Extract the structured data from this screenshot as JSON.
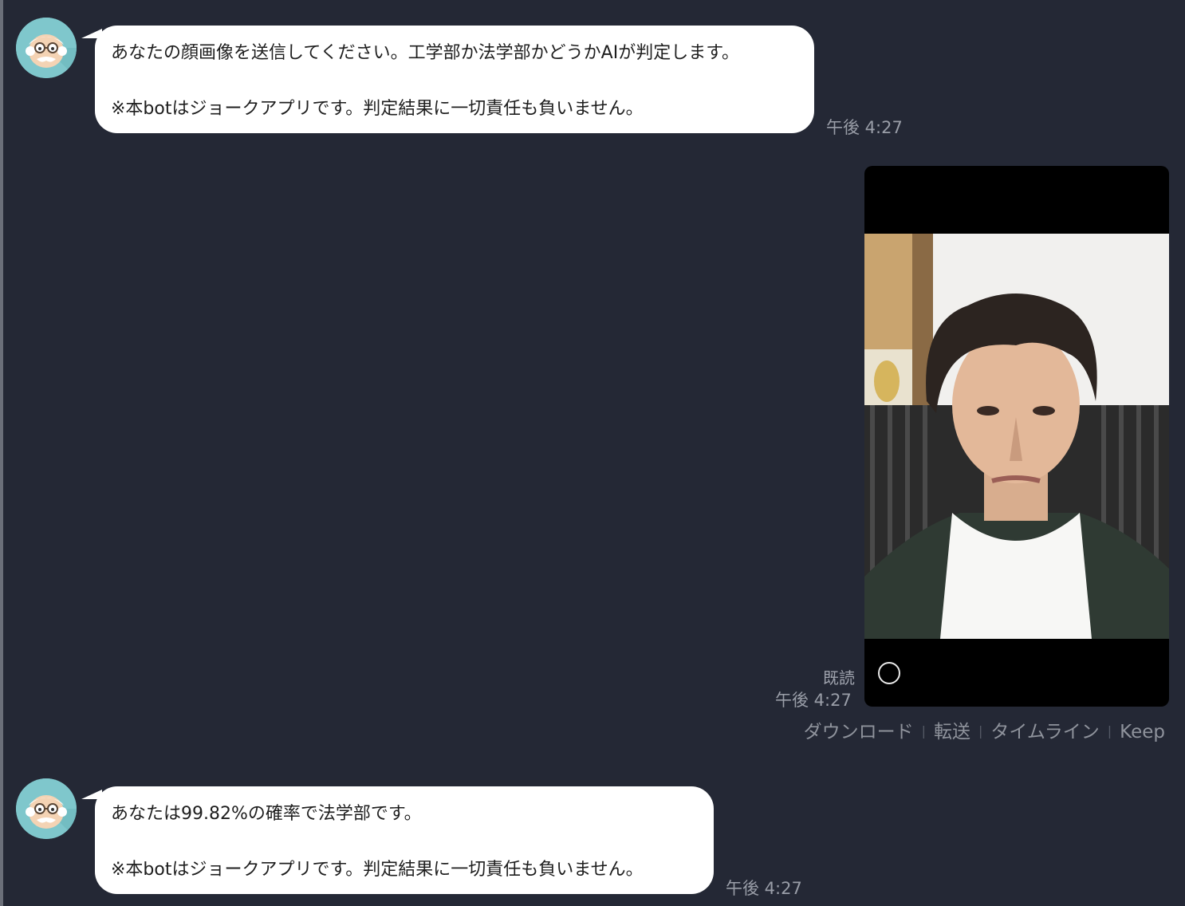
{
  "messages": [
    {
      "sender": "bot",
      "line1": "あなたの顔画像を送信してください。工学部か法学部かどうかAIが判定します。",
      "line2": "※本botはジョークアプリです。判定結果に一切責任も負いません。",
      "time": "午後 4:27"
    },
    {
      "sender": "user",
      "read_label": "既読",
      "time": "午後 4:27"
    },
    {
      "sender": "bot",
      "line1": "あなたは99.82%の確率で法学部です。",
      "line2": "※本botはジョークアプリです。判定結果に一切責任も負いません。",
      "time": "午後 4:27"
    }
  ],
  "image_actions": {
    "download": "ダウンロード",
    "forward": "転送",
    "timeline": "タイムライン",
    "keep": "Keep"
  },
  "icons": {
    "avatar": "professor-avatar-icon",
    "photo_control": "circle-icon"
  },
  "colors": {
    "background": "#242835",
    "bubble": "#ffffff",
    "avatar": "#7fc7cc",
    "meta_text": "#9a9ea8"
  }
}
